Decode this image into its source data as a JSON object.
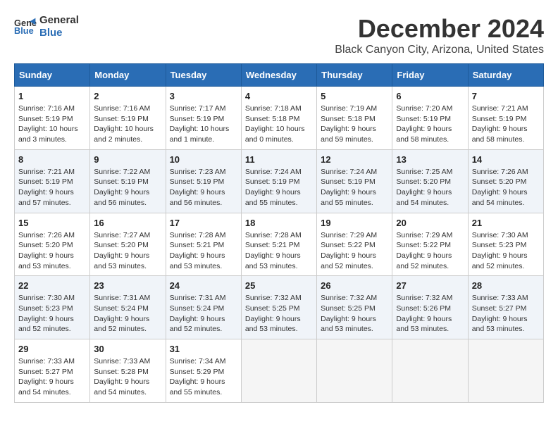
{
  "logo": {
    "line1": "General",
    "line2": "Blue"
  },
  "title": "December 2024",
  "subtitle": "Black Canyon City, Arizona, United States",
  "weekdays": [
    "Sunday",
    "Monday",
    "Tuesday",
    "Wednesday",
    "Thursday",
    "Friday",
    "Saturday"
  ],
  "weeks": [
    [
      {
        "day": "1",
        "sunrise": "Sunrise: 7:16 AM",
        "sunset": "Sunset: 5:19 PM",
        "daylight": "Daylight: 10 hours and 3 minutes."
      },
      {
        "day": "2",
        "sunrise": "Sunrise: 7:16 AM",
        "sunset": "Sunset: 5:19 PM",
        "daylight": "Daylight: 10 hours and 2 minutes."
      },
      {
        "day": "3",
        "sunrise": "Sunrise: 7:17 AM",
        "sunset": "Sunset: 5:19 PM",
        "daylight": "Daylight: 10 hours and 1 minute."
      },
      {
        "day": "4",
        "sunrise": "Sunrise: 7:18 AM",
        "sunset": "Sunset: 5:18 PM",
        "daylight": "Daylight: 10 hours and 0 minutes."
      },
      {
        "day": "5",
        "sunrise": "Sunrise: 7:19 AM",
        "sunset": "Sunset: 5:18 PM",
        "daylight": "Daylight: 9 hours and 59 minutes."
      },
      {
        "day": "6",
        "sunrise": "Sunrise: 7:20 AM",
        "sunset": "Sunset: 5:19 PM",
        "daylight": "Daylight: 9 hours and 58 minutes."
      },
      {
        "day": "7",
        "sunrise": "Sunrise: 7:21 AM",
        "sunset": "Sunset: 5:19 PM",
        "daylight": "Daylight: 9 hours and 58 minutes."
      }
    ],
    [
      {
        "day": "8",
        "sunrise": "Sunrise: 7:21 AM",
        "sunset": "Sunset: 5:19 PM",
        "daylight": "Daylight: 9 hours and 57 minutes."
      },
      {
        "day": "9",
        "sunrise": "Sunrise: 7:22 AM",
        "sunset": "Sunset: 5:19 PM",
        "daylight": "Daylight: 9 hours and 56 minutes."
      },
      {
        "day": "10",
        "sunrise": "Sunrise: 7:23 AM",
        "sunset": "Sunset: 5:19 PM",
        "daylight": "Daylight: 9 hours and 56 minutes."
      },
      {
        "day": "11",
        "sunrise": "Sunrise: 7:24 AM",
        "sunset": "Sunset: 5:19 PM",
        "daylight": "Daylight: 9 hours and 55 minutes."
      },
      {
        "day": "12",
        "sunrise": "Sunrise: 7:24 AM",
        "sunset": "Sunset: 5:19 PM",
        "daylight": "Daylight: 9 hours and 55 minutes."
      },
      {
        "day": "13",
        "sunrise": "Sunrise: 7:25 AM",
        "sunset": "Sunset: 5:20 PM",
        "daylight": "Daylight: 9 hours and 54 minutes."
      },
      {
        "day": "14",
        "sunrise": "Sunrise: 7:26 AM",
        "sunset": "Sunset: 5:20 PM",
        "daylight": "Daylight: 9 hours and 54 minutes."
      }
    ],
    [
      {
        "day": "15",
        "sunrise": "Sunrise: 7:26 AM",
        "sunset": "Sunset: 5:20 PM",
        "daylight": "Daylight: 9 hours and 53 minutes."
      },
      {
        "day": "16",
        "sunrise": "Sunrise: 7:27 AM",
        "sunset": "Sunset: 5:20 PM",
        "daylight": "Daylight: 9 hours and 53 minutes."
      },
      {
        "day": "17",
        "sunrise": "Sunrise: 7:28 AM",
        "sunset": "Sunset: 5:21 PM",
        "daylight": "Daylight: 9 hours and 53 minutes."
      },
      {
        "day": "18",
        "sunrise": "Sunrise: 7:28 AM",
        "sunset": "Sunset: 5:21 PM",
        "daylight": "Daylight: 9 hours and 53 minutes."
      },
      {
        "day": "19",
        "sunrise": "Sunrise: 7:29 AM",
        "sunset": "Sunset: 5:22 PM",
        "daylight": "Daylight: 9 hours and 52 minutes."
      },
      {
        "day": "20",
        "sunrise": "Sunrise: 7:29 AM",
        "sunset": "Sunset: 5:22 PM",
        "daylight": "Daylight: 9 hours and 52 minutes."
      },
      {
        "day": "21",
        "sunrise": "Sunrise: 7:30 AM",
        "sunset": "Sunset: 5:23 PM",
        "daylight": "Daylight: 9 hours and 52 minutes."
      }
    ],
    [
      {
        "day": "22",
        "sunrise": "Sunrise: 7:30 AM",
        "sunset": "Sunset: 5:23 PM",
        "daylight": "Daylight: 9 hours and 52 minutes."
      },
      {
        "day": "23",
        "sunrise": "Sunrise: 7:31 AM",
        "sunset": "Sunset: 5:24 PM",
        "daylight": "Daylight: 9 hours and 52 minutes."
      },
      {
        "day": "24",
        "sunrise": "Sunrise: 7:31 AM",
        "sunset": "Sunset: 5:24 PM",
        "daylight": "Daylight: 9 hours and 52 minutes."
      },
      {
        "day": "25",
        "sunrise": "Sunrise: 7:32 AM",
        "sunset": "Sunset: 5:25 PM",
        "daylight": "Daylight: 9 hours and 53 minutes."
      },
      {
        "day": "26",
        "sunrise": "Sunrise: 7:32 AM",
        "sunset": "Sunset: 5:25 PM",
        "daylight": "Daylight: 9 hours and 53 minutes."
      },
      {
        "day": "27",
        "sunrise": "Sunrise: 7:32 AM",
        "sunset": "Sunset: 5:26 PM",
        "daylight": "Daylight: 9 hours and 53 minutes."
      },
      {
        "day": "28",
        "sunrise": "Sunrise: 7:33 AM",
        "sunset": "Sunset: 5:27 PM",
        "daylight": "Daylight: 9 hours and 53 minutes."
      }
    ],
    [
      {
        "day": "29",
        "sunrise": "Sunrise: 7:33 AM",
        "sunset": "Sunset: 5:27 PM",
        "daylight": "Daylight: 9 hours and 54 minutes."
      },
      {
        "day": "30",
        "sunrise": "Sunrise: 7:33 AM",
        "sunset": "Sunset: 5:28 PM",
        "daylight": "Daylight: 9 hours and 54 minutes."
      },
      {
        "day": "31",
        "sunrise": "Sunrise: 7:34 AM",
        "sunset": "Sunset: 5:29 PM",
        "daylight": "Daylight: 9 hours and 55 minutes."
      },
      null,
      null,
      null,
      null
    ]
  ]
}
